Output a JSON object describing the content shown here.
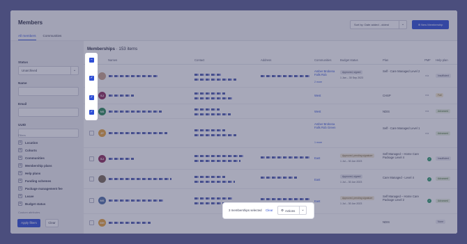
{
  "header": {
    "title": "Members",
    "sort_label": "Sort by: Date added - oldest",
    "new_button": "New Membership",
    "tabs": [
      "All members",
      "Communities"
    ]
  },
  "sidebar": {
    "status_label": "Status",
    "status_value": "Unarchived",
    "name_label": "Name",
    "email_label": "Email",
    "uuid_label": "UUID",
    "filters_heading": "Filters",
    "filters": [
      "Location",
      "Cohorts",
      "Communities",
      "Membership plans",
      "Help plans",
      "Funding schemes",
      "Package management fee",
      "Leave",
      "Budget status"
    ],
    "custom_attributes": "Custom attributes",
    "apply_button": "Apply filters",
    "clear_button": "Clear"
  },
  "main": {
    "heading": "Memberships",
    "count": "· 153 items",
    "columns": [
      "Names",
      "Contact",
      "Address",
      "Communities",
      "Budget status",
      "Plan",
      "PMF",
      "Help plan"
    ],
    "rows": [
      {
        "initials": "",
        "community": "Amber Brobena Falls Rob",
        "more": "2 more",
        "badge": "Approved, signed",
        "dates": "1 Jan – 30 Sep 2023",
        "plan": "Self - Care Managed Level 2",
        "pmf": "n/a",
        "help": "Insufficient"
      },
      {
        "initials": "SJ",
        "community": "West",
        "plan": "CHSP",
        "pmf": "n/a",
        "help": "Fail"
      },
      {
        "initials": "NS",
        "community": "West",
        "plan": "NDIS",
        "pmf": "n/a",
        "help": "Advanced"
      },
      {
        "initials": "JP",
        "community": "Amber Brobena Falls Rob Green",
        "more": "1 more",
        "plan": "Self - Care Managed Level 1",
        "pmf": "n/a",
        "help": "Advanced"
      },
      {
        "initials": "SJ",
        "community": "East",
        "badge": "Approved, pending signature",
        "dates": "1 Jul – 30 Jun 2023",
        "plan": "Self Managed – Home Care Package Level 4",
        "help": "Insufficient"
      },
      {
        "initials": "",
        "community": "East",
        "badge": "Approved, signed",
        "dates": "1 Jul – 30 Jun 2023",
        "plan": "Care Managed - Level 4",
        "help": "Advanced"
      },
      {
        "initials": "MS",
        "community": "East",
        "badge": "Approved, pending signature",
        "dates": "1 Jul – 30 Jun 2023",
        "plan": "Self Managed – Home Care Package Level 2",
        "help": "Advanced"
      },
      {
        "initials": "MH",
        "community": "",
        "plan": "NDIS",
        "help": "None"
      }
    ]
  },
  "action_bar": {
    "count": "3 memberships selected",
    "clear": "Clear",
    "actions": "Actions"
  },
  "colors": {
    "accent": "#2f4fd6",
    "backdrop": "#4b4e7d"
  }
}
